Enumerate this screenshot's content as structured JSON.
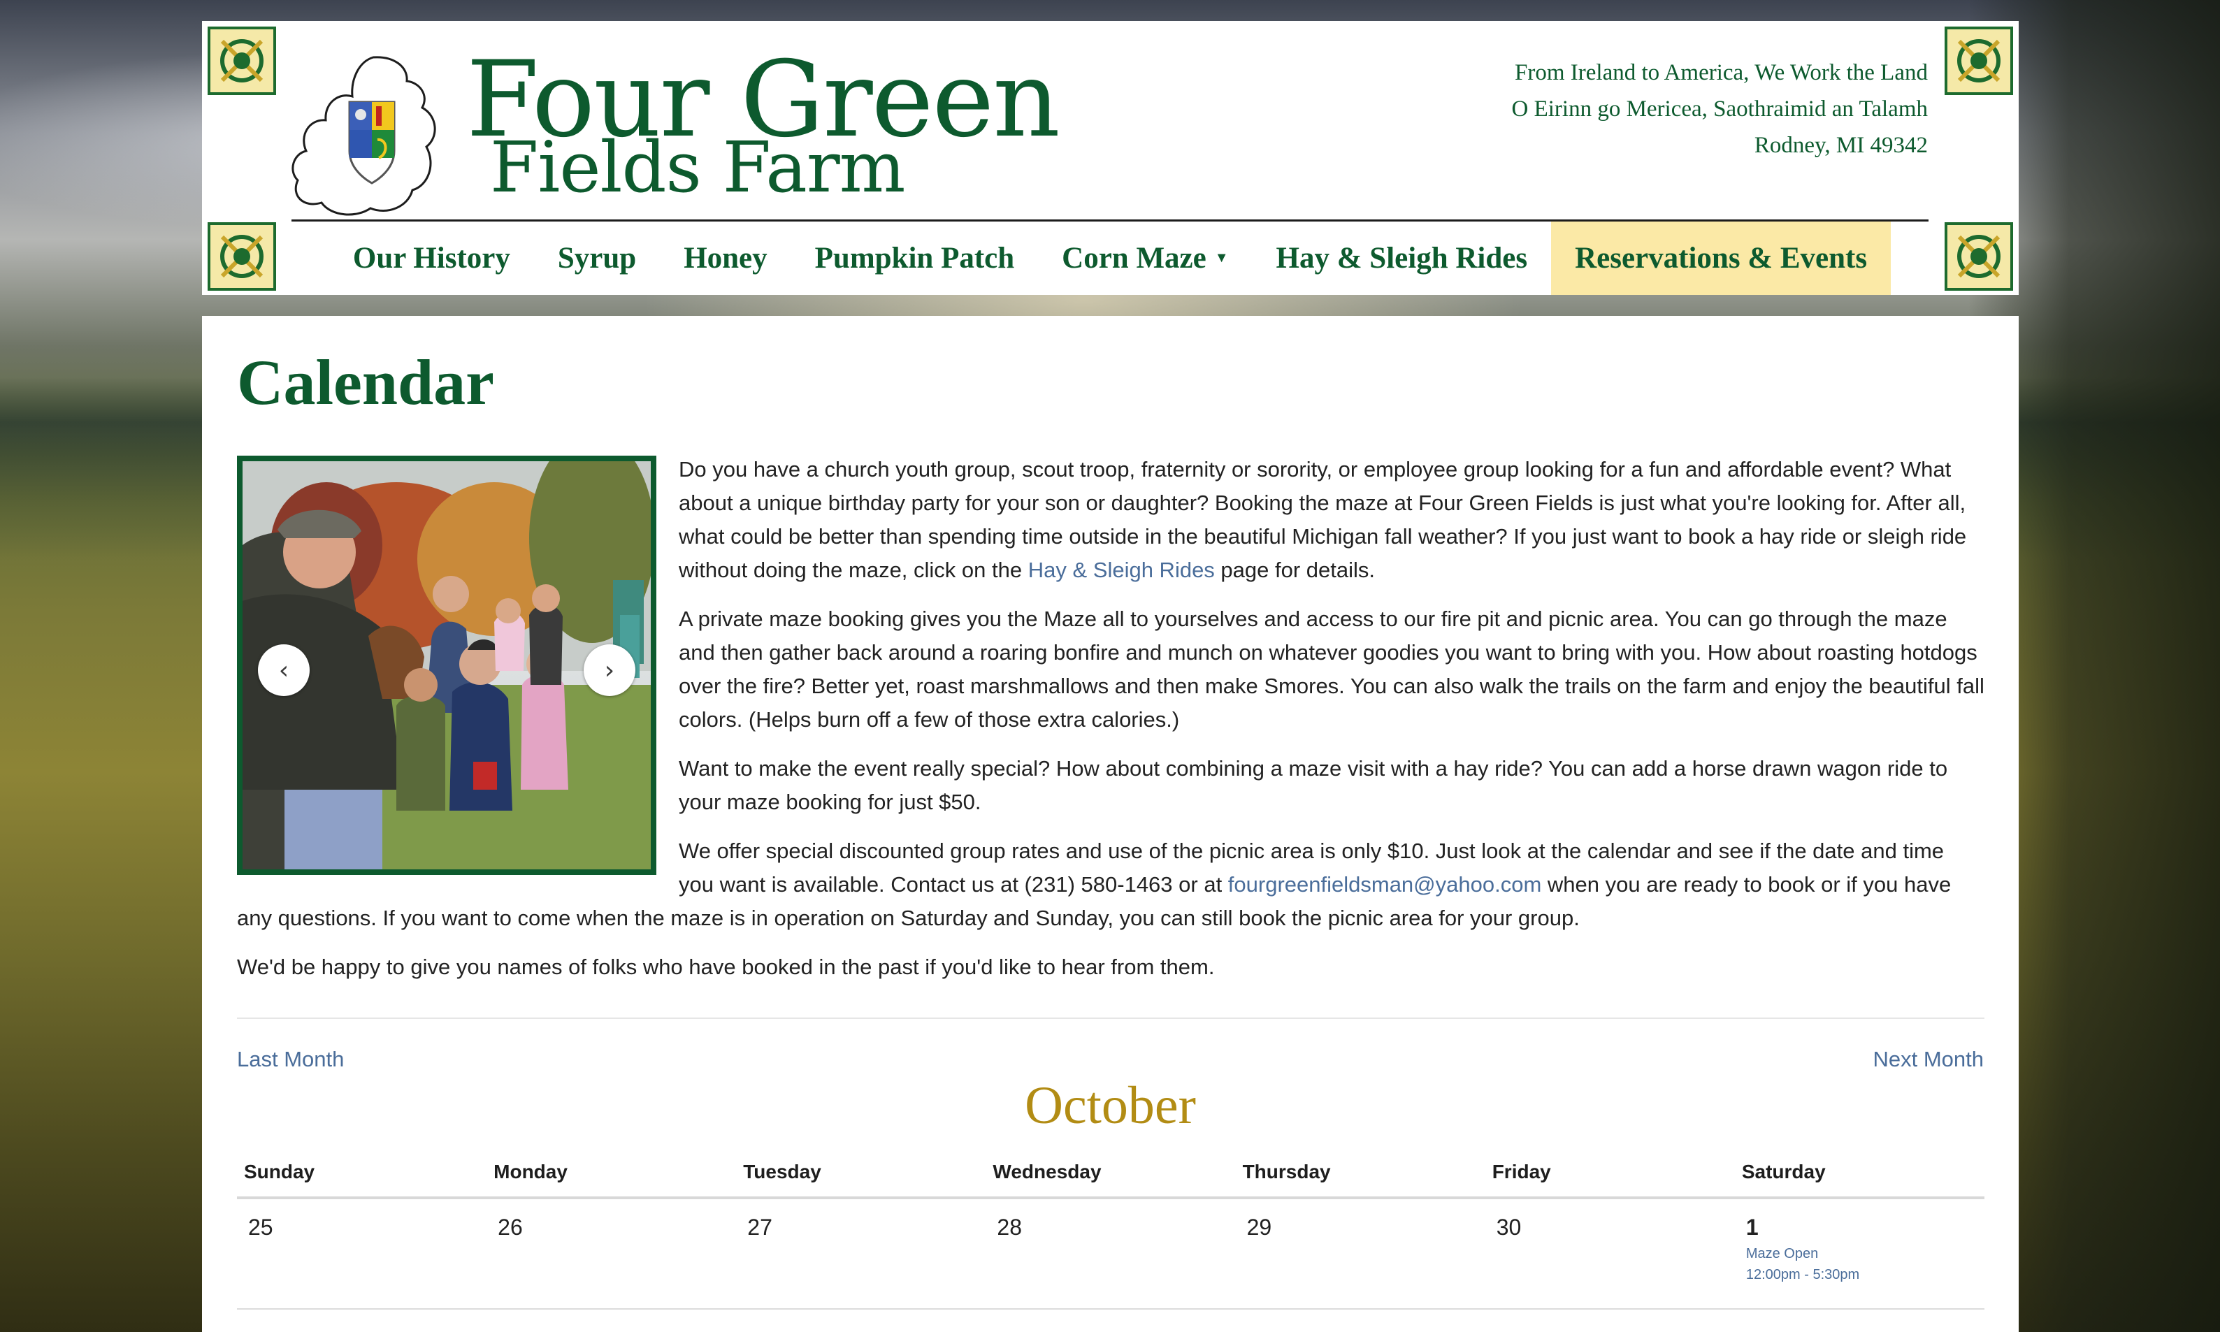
{
  "header": {
    "brand_line1": "Four Green",
    "brand_line2": "Fields Farm",
    "tagline": [
      "From Ireland to America, We Work the Land",
      "O Eirinn go Mericea, Saothraimid an Talamh",
      "Rodney, MI 49342"
    ]
  },
  "nav": {
    "items": [
      {
        "label": "Our History"
      },
      {
        "label": "Syrup"
      },
      {
        "label": "Honey"
      },
      {
        "label": "Pumpkin Patch"
      },
      {
        "label": "Corn Maze"
      },
      {
        "label": "Hay & Sleigh Rides"
      },
      {
        "label": "Reservations & Events"
      }
    ],
    "active_index": 6
  },
  "main": {
    "title": "Calendar",
    "carousel": {
      "prev_icon": "chevron-left-icon",
      "next_icon": "chevron-right-icon",
      "prev_glyph": "‹",
      "next_glyph": "›"
    },
    "p1_before": "Do you have a church youth group, scout troop, fraternity or sorority, or employee group looking for a fun and affordable event? What about a unique birthday party for your son or daughter? Booking the maze at Four Green Fields is just what you're looking for. After all, what could be better than spending time outside in the beautiful Michigan fall weather? If you just want to book a hay ride or sleigh ride without doing the maze, click on the ",
    "p1_link": "Hay & Sleigh Rides",
    "p1_after": " page for details.",
    "p2": "A private maze booking gives you the Maze all to yourselves and access to our fire pit and picnic area. You can go through the maze and then gather back around a roaring bonfire and munch on whatever goodies you want to bring with you. How about roasting hotdogs over the fire? Better yet, roast marshmallows and then make Smores. You can also walk the trails on the farm and enjoy the beautiful fall colors. (Helps burn off a few of those extra calories.)",
    "p3": "Want to make the event really special? How about combining a maze visit with a hay ride? You can add a horse drawn wagon ride to your maze booking for just $50.",
    "p4_before": "We offer special discounted group rates and use of the picnic area is only $10. Just look at the calendar and see if the date and time you want is available. Contact us at (231) 580-1463 or at ",
    "p4_link": "fourgreenfieldsman@yahoo.com",
    "p4_after": " when you are ready to book or if you have any questions. If you want to come when the maze is in operation on Saturday and Sunday, you can still book the picnic area for your group.",
    "p5": "We'd be happy to give you names of folks who have booked in the past if you'd like to hear from them."
  },
  "calendar": {
    "last_month": "Last Month",
    "next_month": "Next Month",
    "month": "October",
    "weekdays": [
      "Sunday",
      "Monday",
      "Tuesday",
      "Wednesday",
      "Thursday",
      "Friday",
      "Saturday"
    ],
    "week1": [
      {
        "day": "25"
      },
      {
        "day": "26"
      },
      {
        "day": "27"
      },
      {
        "day": "28"
      },
      {
        "day": "29"
      },
      {
        "day": "30"
      },
      {
        "day": "1",
        "event_title": "Maze Open",
        "event_time": "12:00pm - 5:30pm"
      }
    ]
  },
  "colors": {
    "brand_green": "#0d5a2e",
    "active_nav_bg": "#fbe9a6",
    "month_gold": "#b28c14",
    "link_blue": "#4a6d9a"
  }
}
